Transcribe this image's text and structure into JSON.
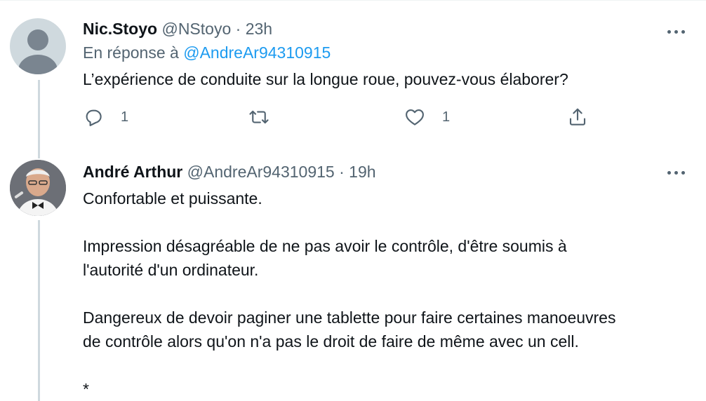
{
  "tweets": [
    {
      "name": "Nic.Stoyo",
      "handle": "@NStoyo",
      "separator": "·",
      "time": "23h",
      "reply_prefix": "En réponse à",
      "reply_mention": "@AndreAr94310915",
      "text": "L’expérience de conduite sur la longue roue, pouvez-vous élaborer?",
      "actions": {
        "reply_count": "1",
        "retweet_count": "",
        "like_count": "1"
      },
      "avatar": "default-avatar-icon"
    },
    {
      "name": "André Arthur",
      "handle": "@AndreAr94310915",
      "separator": "·",
      "time": "19h",
      "paragraphs": [
        "Confortable et puissante.",
        "Impression désagréable de ne pas avoir le contrôle, d'être soumis à\nl'autorité d'un ordinateur.",
        "Dangereux de devoir paginer une tablette pour faire certaines manoeuvres\nde contrôle alors qu'on n'a pas le droit de faire de même avec un cell.",
        "*"
      ],
      "avatar": "profile-photo"
    }
  ],
  "colors": {
    "text_primary": "#0f1419",
    "text_secondary": "#536471",
    "link": "#1d9bf0",
    "thread_line": "#cfd9de"
  }
}
